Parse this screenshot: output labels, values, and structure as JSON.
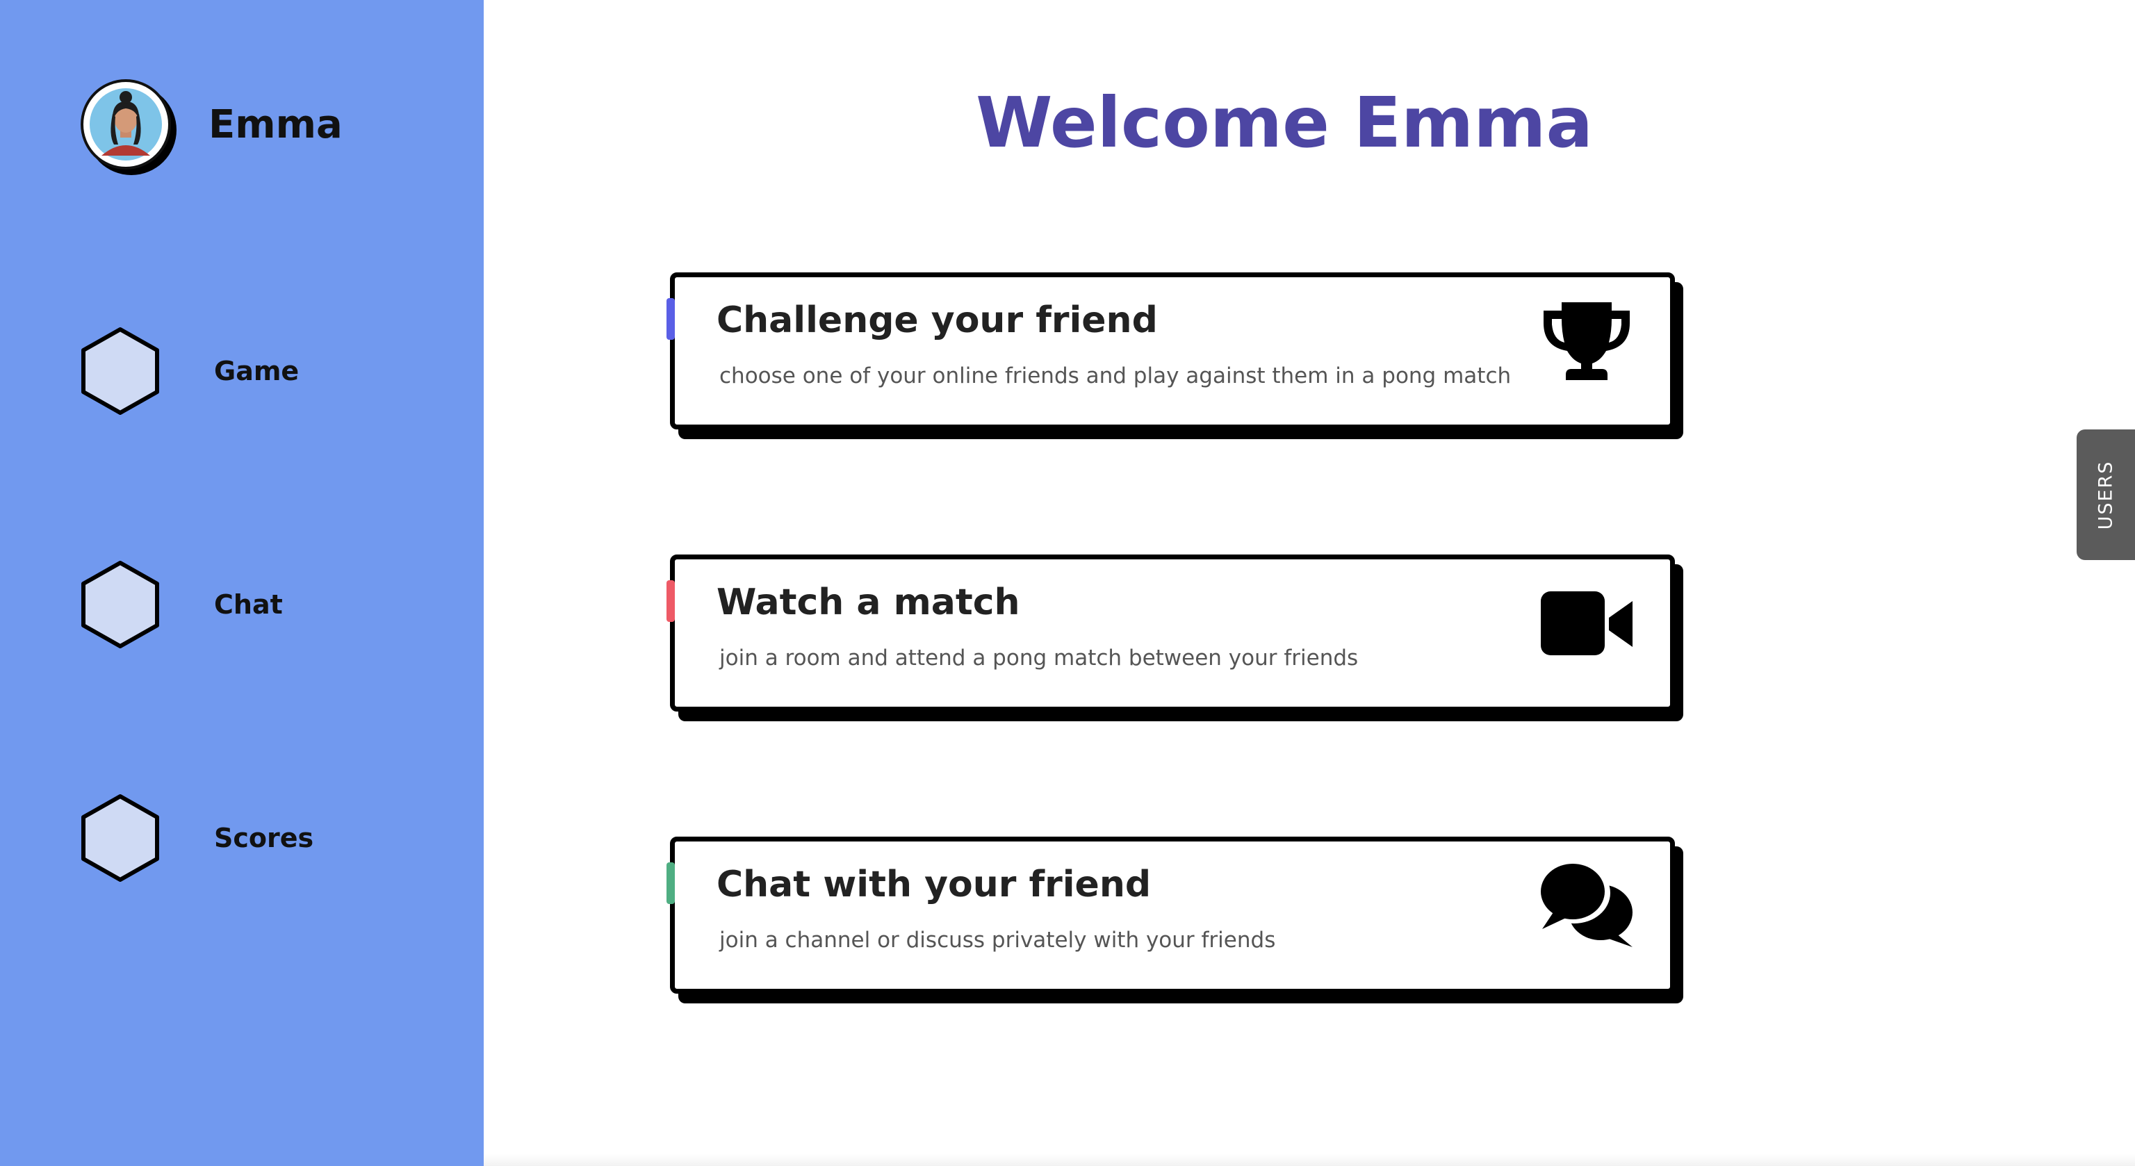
{
  "user": {
    "name": "Emma"
  },
  "sidebar": {
    "items": [
      {
        "label": "Game",
        "icon": "hexagon-icon"
      },
      {
        "label": "Chat",
        "icon": "hexagon-icon"
      },
      {
        "label": "Scores",
        "icon": "hexagon-icon"
      }
    ]
  },
  "main": {
    "welcome": "Welcome Emma",
    "cards": [
      {
        "title": "Challenge your friend",
        "description": "choose one of your online friends and play against them in a pong match",
        "icon": "trophy-icon",
        "accent": "#5a5fe6"
      },
      {
        "title": "Watch a match",
        "description": "join a room and attend a pong match between your friends",
        "icon": "video-camera-icon",
        "accent": "#ee5a66"
      },
      {
        "title": "Chat with your friend",
        "description": "join a channel or discuss privately with your friends",
        "icon": "chat-bubbles-icon",
        "accent": "#4fae82"
      }
    ]
  },
  "users_tab": {
    "label": "USERS"
  },
  "colors": {
    "sidebar": "#7199ef",
    "title": "#4d46a3",
    "hexagon_fill": "#cfdaf4"
  }
}
